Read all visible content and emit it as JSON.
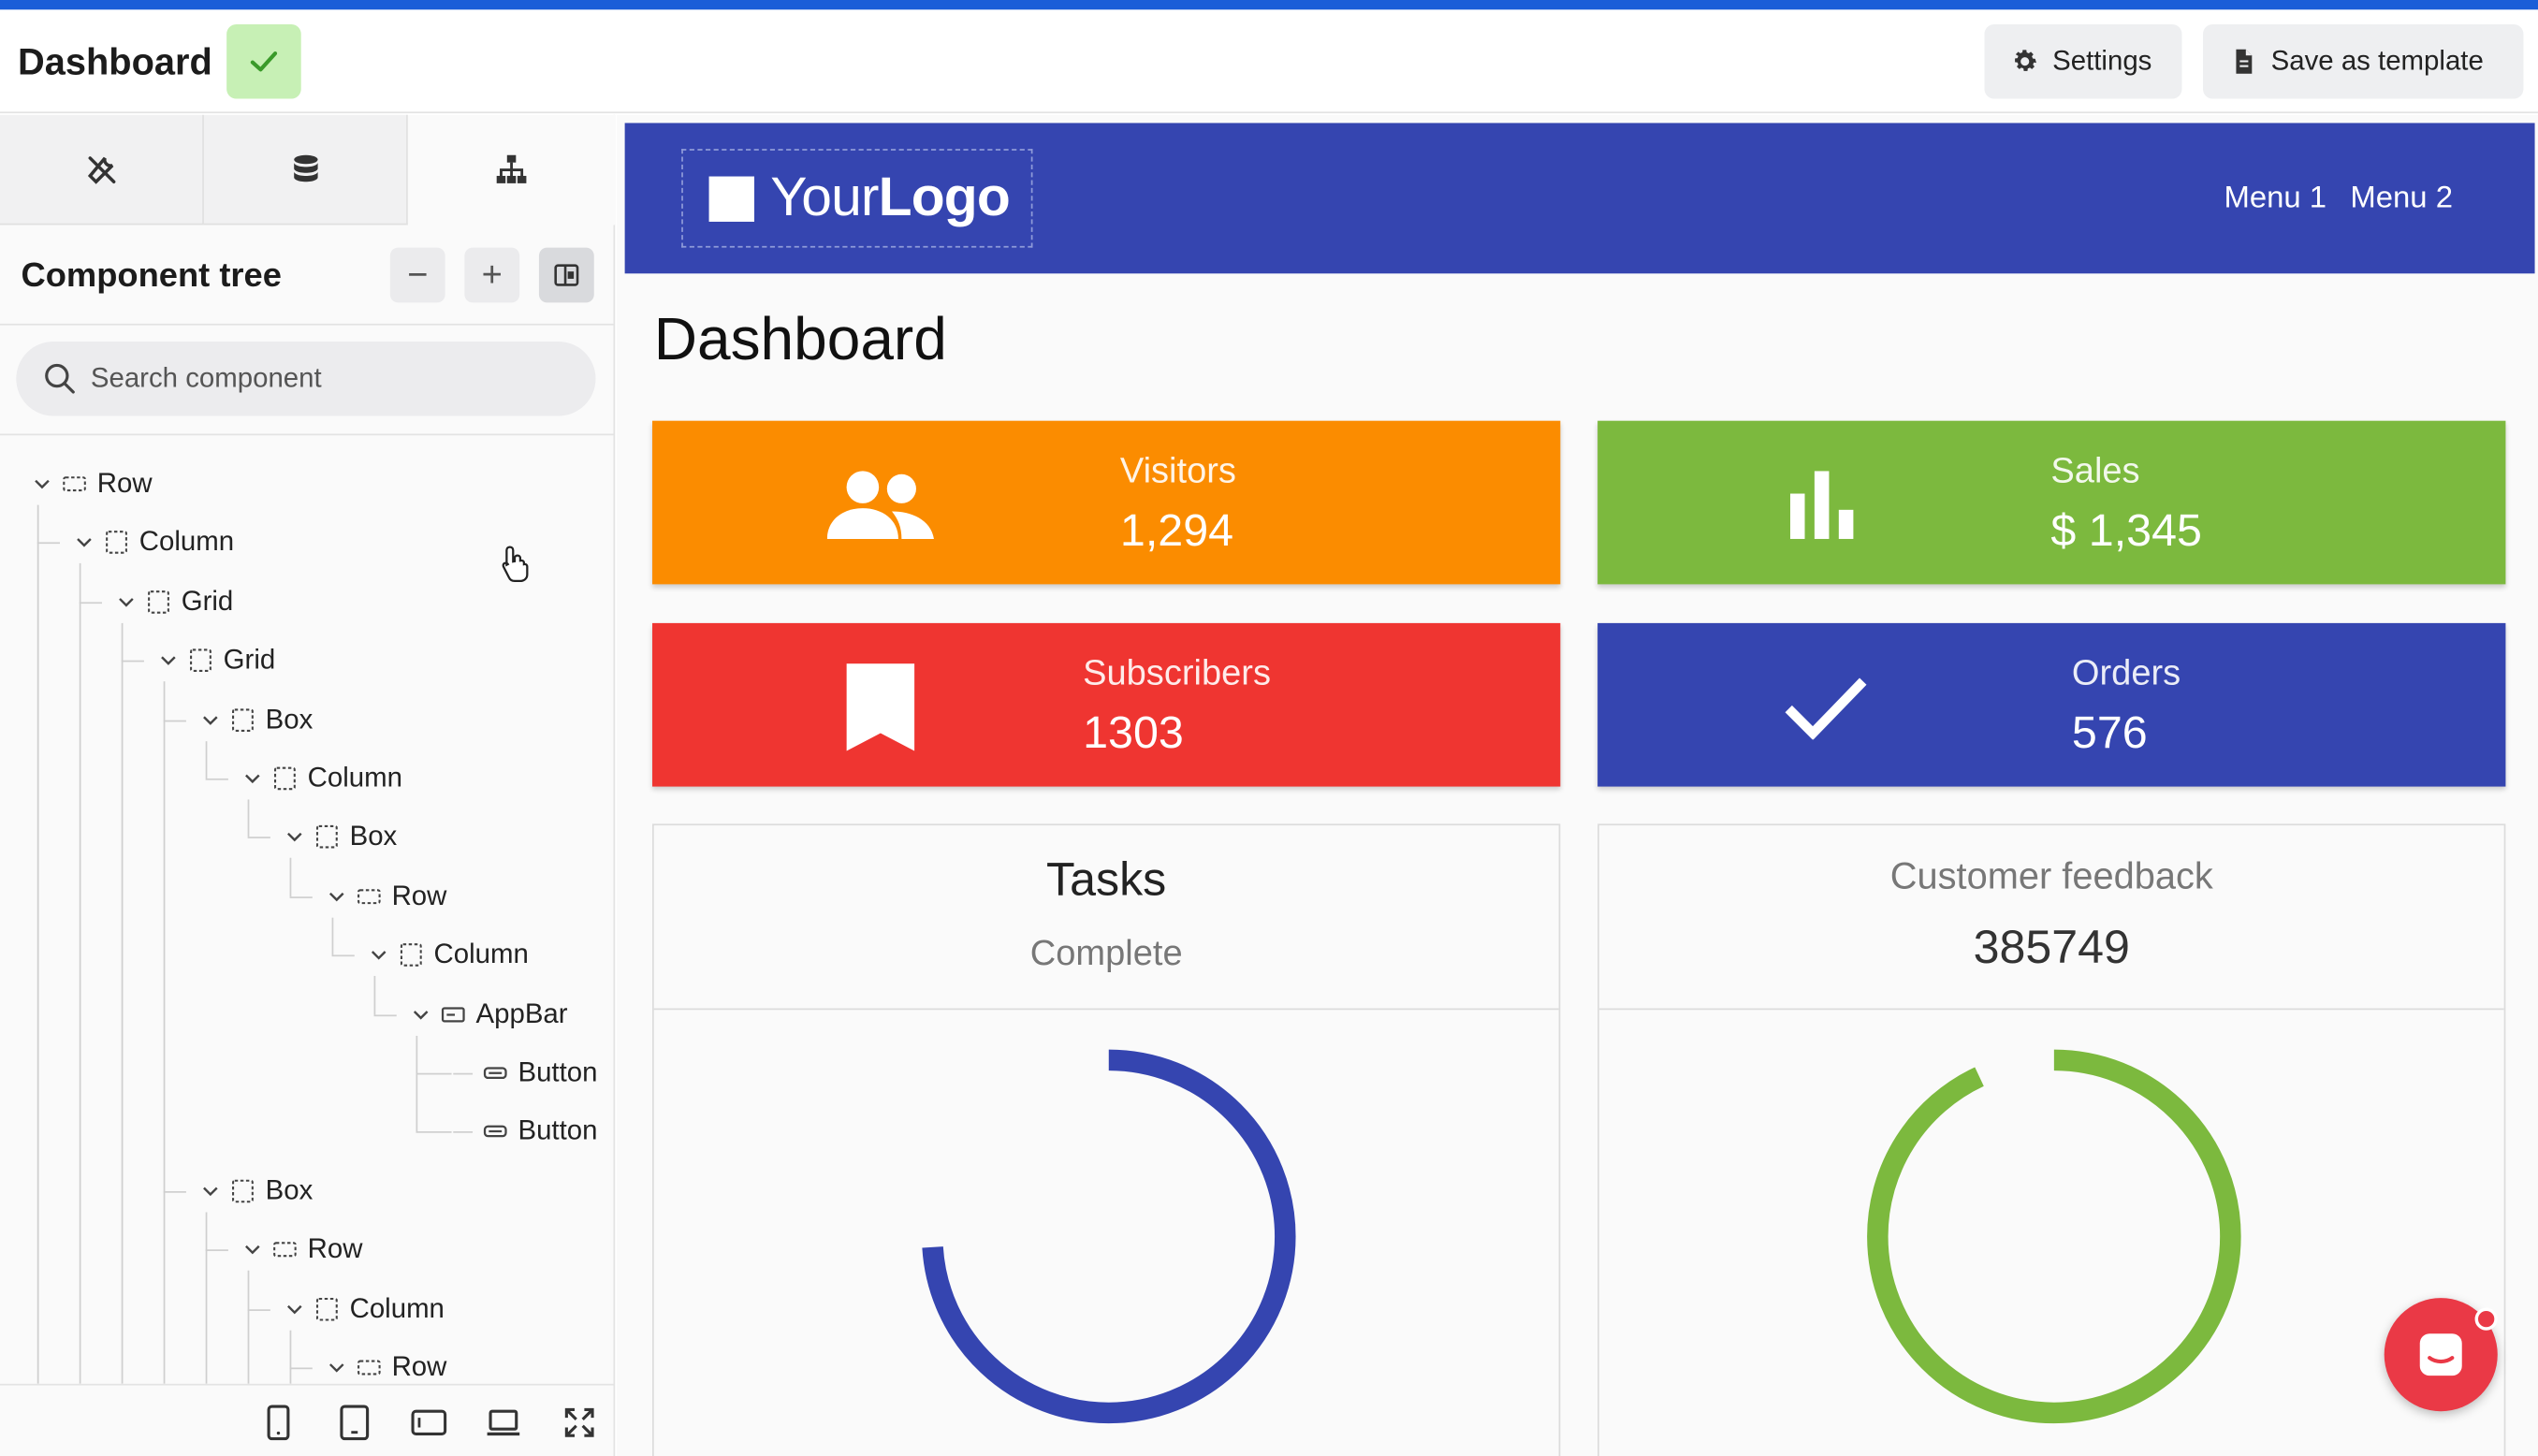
{
  "app": {
    "title": "Dashboard",
    "settings_label": "Settings",
    "save_template_label": "Save as template",
    "accent": "#1a5ed8",
    "saved_chip_color": "#c7f0b5"
  },
  "left_panel": {
    "tabs": [
      {
        "icon": "tools-icon"
      },
      {
        "icon": "database-icon"
      },
      {
        "icon": "sitemap-icon",
        "active": true
      }
    ],
    "tree_title": "Component tree",
    "collapse_label": "−",
    "expand_label": "+",
    "search_placeholder": "Search component",
    "tree": [
      {
        "label": "Row",
        "icon": "row-icon",
        "depth": 0
      },
      {
        "label": "Column",
        "icon": "column-icon",
        "depth": 1
      },
      {
        "label": "Grid",
        "icon": "grid-icon",
        "depth": 2
      },
      {
        "label": "Grid",
        "icon": "grid-icon",
        "depth": 3
      },
      {
        "label": "Box",
        "icon": "box-icon",
        "depth": 4
      },
      {
        "label": "Column",
        "icon": "column-icon",
        "depth": 5
      },
      {
        "label": "Box",
        "icon": "box-icon",
        "depth": 6
      },
      {
        "label": "Row",
        "icon": "row-icon",
        "depth": 7
      },
      {
        "label": "Column",
        "icon": "column-icon",
        "depth": 8
      },
      {
        "label": "AppBar",
        "icon": "appbar-icon",
        "depth": 9
      },
      {
        "label": "Button",
        "icon": "button-icon",
        "depth": 10
      },
      {
        "label": "Button",
        "icon": "button-icon",
        "depth": 10
      },
      {
        "label": "Box",
        "icon": "box-icon",
        "depth": 4
      },
      {
        "label": "Row",
        "icon": "row-icon",
        "depth": 5
      },
      {
        "label": "Column",
        "icon": "column-icon",
        "depth": 6
      },
      {
        "label": "Row",
        "icon": "row-icon",
        "depth": 7
      }
    ],
    "devices": [
      "phone-icon",
      "tablet-icon",
      "tablet-landscape-icon",
      "laptop-icon",
      "fullscreen-icon"
    ]
  },
  "site": {
    "logo_prefix": "Your",
    "logo_bold": "Logo",
    "menu": [
      "Menu 1",
      "Menu 2"
    ],
    "page_title": "Dashboard",
    "header_color": "#3545b0",
    "stats": [
      {
        "label": "Visitors",
        "value": "1,294",
        "color": "#fb8c00",
        "icon": "people-icon"
      },
      {
        "label": "Sales",
        "value": "$ 1,345",
        "color": "#7cb93e",
        "icon": "bar-chart-icon"
      },
      {
        "label": "Subscribers",
        "value": "1303",
        "color": "#ef3531",
        "icon": "bookmark-icon"
      },
      {
        "label": "Orders",
        "value": "576",
        "color": "#3545b0",
        "icon": "checkmark-icon"
      }
    ],
    "tasks": {
      "title": "Tasks",
      "subtitle": "Complete",
      "progress": 0.74,
      "color": "#3545b0"
    },
    "feedback": {
      "title": "Customer feedback",
      "value": "385749",
      "progress": 0.93,
      "color": "#7cb93e"
    }
  }
}
